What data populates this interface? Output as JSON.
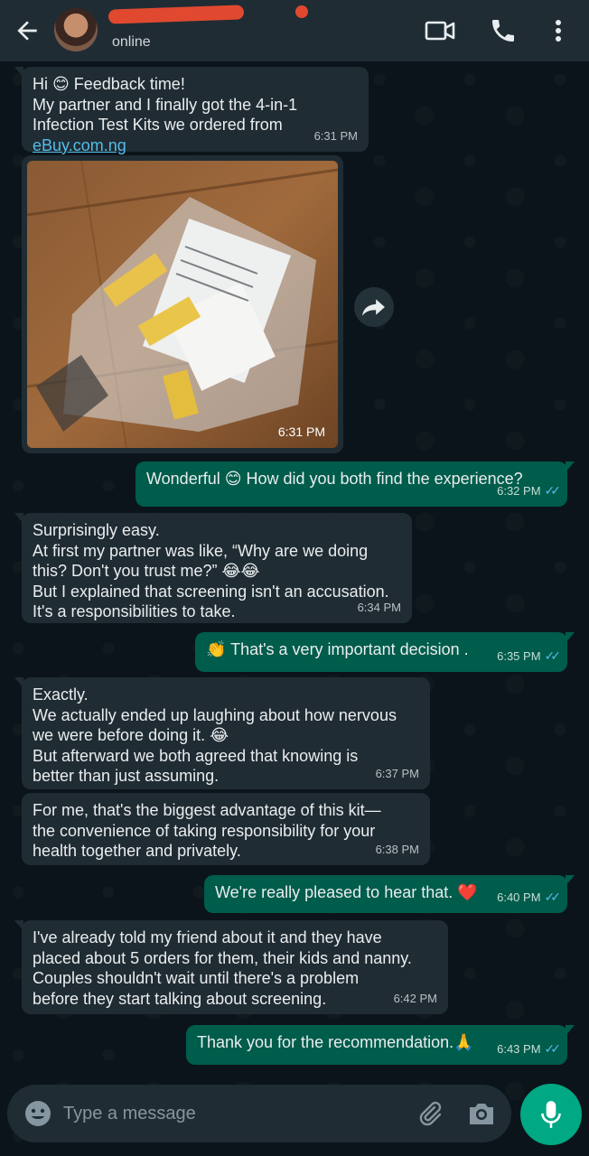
{
  "header": {
    "status": "online",
    "icons": {
      "back": "back-arrow-icon",
      "video": "video-call-icon",
      "call": "phone-icon",
      "menu": "more-vert-icon"
    }
  },
  "messages": [
    {
      "dir": "in",
      "lines": [
        "Hi 😊 Feedback time!",
        "My partner and I finally got the 4-in-1",
        "Infection Test Kits we ordered from"
      ],
      "link": "eBuy.com.ng",
      "time": "6:31 PM"
    },
    {
      "dir": "in",
      "type": "image",
      "time": "6:31 PM"
    },
    {
      "dir": "out",
      "text": "Wonderful 😊 How did you both find the experience?",
      "time": "6:32 PM"
    },
    {
      "dir": "in",
      "lines": [
        "Surprisingly easy.",
        "At first my partner was like, “Why are we doing",
        "this? Don't you trust me?” 😂😂",
        "But I explained that screening isn't an accusation.",
        "It's a responsibilities to take."
      ],
      "time": "6:34 PM"
    },
    {
      "dir": "out",
      "text": "👏 That's a very important decision .",
      "time": "6:35 PM"
    },
    {
      "dir": "in",
      "lines": [
        "Exactly.",
        "We actually ended up laughing about how nervous",
        "we were before doing it. 😂",
        "But afterward we both agreed that knowing is",
        "better than just assuming."
      ],
      "time": "6:37 PM"
    },
    {
      "dir": "in",
      "lines": [
        "For me, that's the biggest advantage of this kit—",
        "the convenience of taking responsibility for your",
        "health together and privately."
      ],
      "time": "6:38 PM"
    },
    {
      "dir": "out",
      "text": "We're really pleased to hear that. ❤️",
      "time": "6:40 PM"
    },
    {
      "dir": "in",
      "lines": [
        "I've already told my friend about it and they have",
        "placed about 5 orders for them, their kids and nanny.",
        "Couples shouldn't wait until there's a problem",
        "before they start talking about screening."
      ],
      "time": "6:42 PM"
    },
    {
      "dir": "out",
      "text": "Thank you for the recommendation.🙏",
      "time": "6:43 PM"
    }
  ],
  "ticks": "✓✓",
  "composer": {
    "placeholder": "Type a message"
  },
  "colors": {
    "header": "#1f2c34",
    "incoming": "#202c33",
    "outgoing": "#005c4b",
    "accent": "#00a884",
    "tick_read": "#53bdeb"
  }
}
